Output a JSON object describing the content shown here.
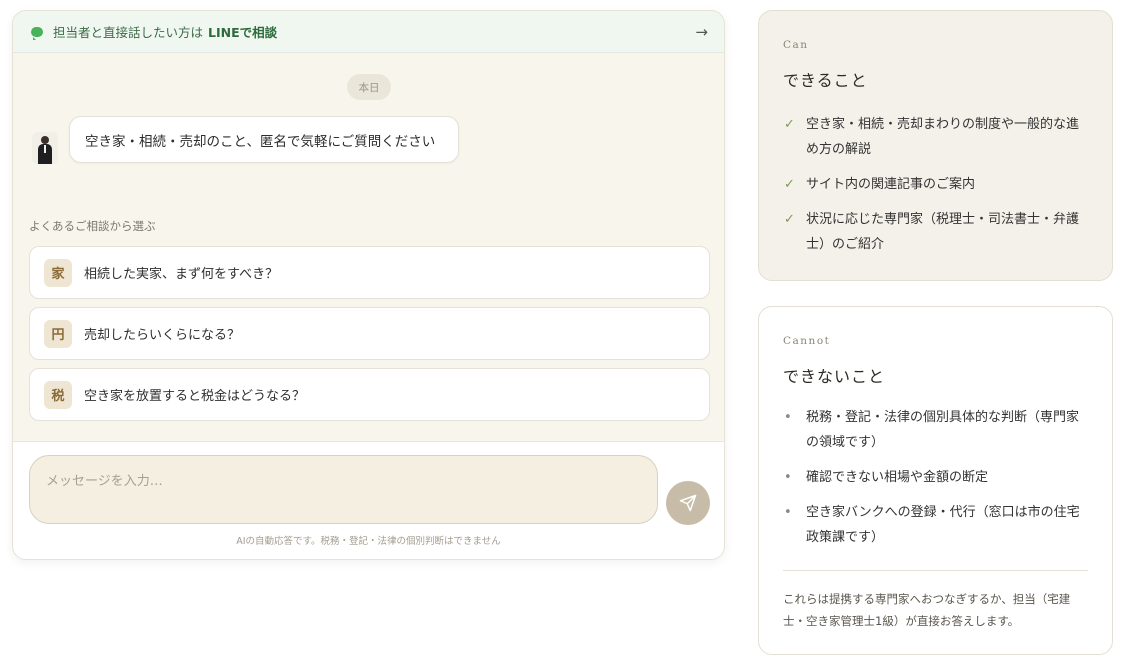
{
  "chat": {
    "line_bar": {
      "text": "担当者と直接話したい方は",
      "link": "LINEで相談",
      "arrow": "→"
    },
    "date_chip": "本日",
    "greeting": "空き家・相続・売却のこと、匿名で気軽にご質問ください",
    "faq_label": "よくあるご相談から選ぶ",
    "faq": [
      {
        "kanji": "家",
        "text": "相続した実家、まず何をすべき？"
      },
      {
        "kanji": "円",
        "text": "売却したらいくらになる？"
      },
      {
        "kanji": "税",
        "text": "空き家を放置すると税金はどうなる？"
      }
    ],
    "input_placeholder": "メッセージを入力…",
    "disclaimer": "AIの自動応答です。税務・登記・法律の個別判断はできません"
  },
  "can": {
    "eyebrow": "Can",
    "title": "できること",
    "items": [
      "空き家・相続・売却まわりの制度や一般的な進め方の解説",
      "サイト内の関連記事のご案内",
      "状況に応じた専門家（税理士・司法書士・弁護士）のご紹介"
    ],
    "check_mark": "✓"
  },
  "cannot": {
    "eyebrow": "Cannot",
    "title": "できないこと",
    "items": [
      "税務・登記・法律の個別具体的な判断（専門家の領域です）",
      "確認できない相場や金額の断定",
      "空き家バンクへの登録・代行（窓口は市の住宅政策課です）"
    ],
    "bullet": "•",
    "note": "これらは提携する専門家へおつなぎするか、担当（宅建士・空き家管理士1級）が直接お答えします。"
  },
  "colors": {
    "line_green": "#49b15a",
    "accent_check": "#7e9a4f",
    "kanji_bg": "#eee6d3",
    "send_button": "#c7bca8"
  }
}
